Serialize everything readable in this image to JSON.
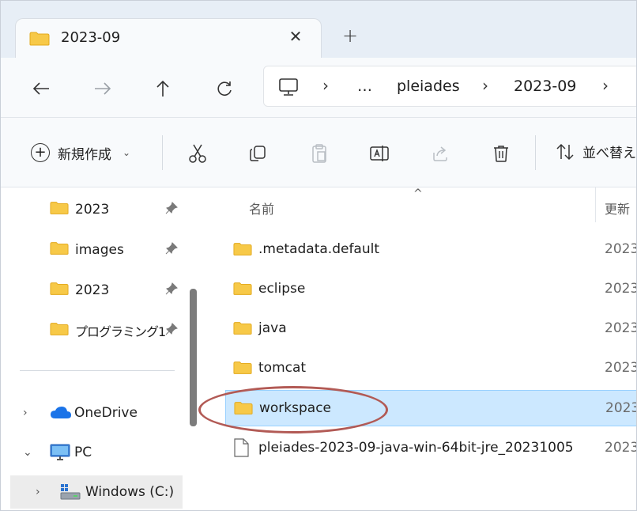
{
  "tab": {
    "title": "2023-09",
    "close": "✕",
    "new": "+"
  },
  "nav": {
    "back": "←",
    "forward": "→",
    "up": "↑",
    "refresh": "↻"
  },
  "address": {
    "crumbs": [
      "…",
      "pleiades",
      "2023-09"
    ],
    "separator": "›"
  },
  "commands": {
    "new_label": "新規作成",
    "new_plus": "+",
    "new_caret": "⌄",
    "sort_label": "並べ替え",
    "icons": [
      "cut-icon",
      "copy-icon",
      "paste-icon",
      "rename-icon",
      "share-icon",
      "delete-icon",
      "sort-icon"
    ]
  },
  "sidebar": {
    "quick_access": [
      {
        "label": "2023",
        "pinned": true
      },
      {
        "label": "images",
        "pinned": true
      },
      {
        "label": "2023",
        "pinned": true
      },
      {
        "label": "プログラミング1",
        "pinned": true
      }
    ],
    "tree": [
      {
        "label": "OneDrive",
        "arrow": "›",
        "icon": "onedrive-icon"
      },
      {
        "label": "PC",
        "arrow": "⌄",
        "icon": "pc-icon"
      },
      {
        "label": "Windows (C:)",
        "arrow": "›",
        "icon": "drive-icon"
      }
    ]
  },
  "list": {
    "columns": {
      "name": "名前",
      "date": "更新",
      "sort_caret": "^"
    },
    "rows": [
      {
        "name": ".metadata.default",
        "date": "2023",
        "type": "folder",
        "selected": false
      },
      {
        "name": "eclipse",
        "date": "2023",
        "type": "folder",
        "selected": false
      },
      {
        "name": "java",
        "date": "2023",
        "type": "folder",
        "selected": false
      },
      {
        "name": "tomcat",
        "date": "2023",
        "type": "folder",
        "selected": false
      },
      {
        "name": "workspace",
        "date": "2023",
        "type": "folder",
        "selected": true
      },
      {
        "name": "pleiades-2023-09-java-win-64bit-jre_20231005",
        "date": "2023",
        "type": "file",
        "selected": false
      }
    ]
  },
  "colors": {
    "folder": "#f7c948",
    "folder_dark": "#e3a91d",
    "selection": "#cce8ff",
    "annotation": "#b25a55",
    "onedrive": "#1a73e8"
  }
}
